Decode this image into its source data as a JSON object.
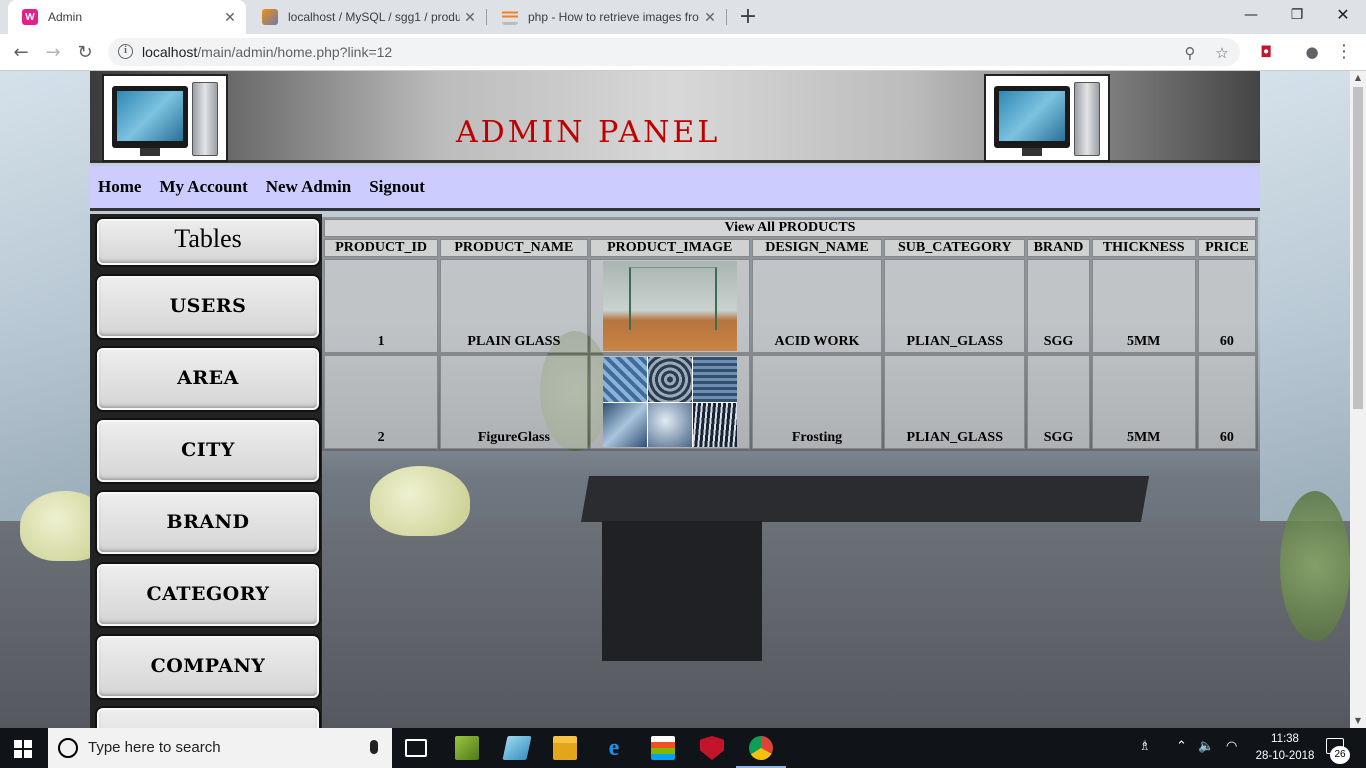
{
  "browser": {
    "tabs": [
      {
        "title": "Admin",
        "active": true,
        "favicon": "wamp-favicon",
        "color": "#e41f8a"
      },
      {
        "title": "localhost / MySQL / sgg1 / produ",
        "active": false,
        "favicon": "phpmyadmin-favicon",
        "color": "#f29111"
      },
      {
        "title": "php - How to retrieve images fro",
        "active": false,
        "favicon": "stackoverflow-favicon",
        "color": "#f48024"
      }
    ],
    "new_tab_symbol": "+",
    "close_symbol": "✕",
    "window_controls": {
      "minimize": "—",
      "maximize": "❐",
      "close": "✕"
    },
    "address": {
      "host": "localhost",
      "path": "/main/admin/home.php?link=12"
    },
    "nav": {
      "back": "←",
      "forward": "→",
      "reload": "↻",
      "info": "i"
    },
    "toolbar_icons": {
      "zoom": "⚲",
      "bookmark": "☆",
      "extension": "◘",
      "profile": "●",
      "menu": "⋮"
    }
  },
  "admin": {
    "title": "ADMIN PANEL",
    "nav_links": [
      "Home",
      "My Account",
      "New Admin",
      "Signout"
    ],
    "sidebar": {
      "heading": "Tables",
      "items": [
        "USERS",
        "AREA",
        "CITY",
        "BRAND",
        "CATEGORY",
        "COMPANY",
        ""
      ]
    },
    "products": {
      "caption": "View All PRODUCTS",
      "columns": [
        "PRODUCT_ID",
        "PRODUCT_NAME",
        "PRODUCT_IMAGE",
        "DESIGN_NAME",
        "SUB_CATEGORY",
        "BRAND",
        "THICKNESS",
        "PRICE"
      ],
      "rows": [
        {
          "id": "1",
          "name": "PLAIN GLASS",
          "image": "plain-glass-image",
          "design": "ACID WORK",
          "sub_category": "PLIAN_GLASS",
          "brand": "SGG",
          "thickness": "5MM",
          "price": "60"
        },
        {
          "id": "2",
          "name": "FigureGlass",
          "image": "figure-glass-image",
          "design": "Frosting",
          "sub_category": "PLIAN_GLASS",
          "brand": "SGG",
          "thickness": "5MM",
          "price": "60"
        }
      ]
    },
    "colors": {
      "title": "#c00000",
      "navbar": "#ccccff"
    }
  },
  "taskbar": {
    "search_placeholder": "Type here to search",
    "time": "11:38",
    "date": "28-10-2018",
    "notification_count": "26",
    "tray_icons": {
      "people": "♗",
      "chevron": "⌃",
      "volume": "🔈",
      "wifi": "◠"
    }
  }
}
